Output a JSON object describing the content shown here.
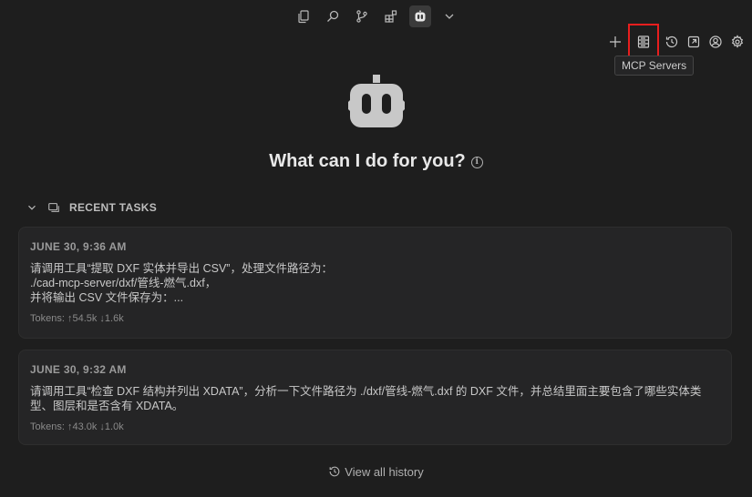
{
  "activity_bar": {
    "icons": [
      "copy-icon",
      "search-icon",
      "source-control-icon",
      "extensions-icon",
      "robot-icon",
      "chevron-down-icon"
    ]
  },
  "toolbar": {
    "icons": [
      "plus-icon",
      "mcp-servers-icon",
      "history-icon",
      "popout-icon",
      "account-icon",
      "settings-icon"
    ],
    "tooltip": "MCP Servers",
    "highlight_color": "#e81e1e"
  },
  "hero": {
    "title": "What can I do for you?",
    "info_glyph": "i"
  },
  "recent": {
    "header": "RECENT TASKS",
    "tasks": [
      {
        "date": "JUNE 30, 9:36 AM",
        "text": "请调用工具“提取 DXF 实体并导出 CSV”，处理文件路径为：\n./cad-mcp-server/dxf/管线-燃气.dxf，\n并将输出 CSV 文件保存为：...",
        "tokens": "Tokens: ↑54.5k ↓1.6k"
      },
      {
        "date": "JUNE 30, 9:32 AM",
        "text": "请调用工具“检查 DXF 结构并列出 XDATA”，分析一下文件路径为 ./dxf/管线-燃气.dxf 的 DXF 文件，并总结里面主要包含了哪些实体类型、图层和是否含有 XDATA。",
        "tokens": "Tokens: ↑43.0k ↓1.0k"
      }
    ]
  },
  "footer": {
    "view_all": "View all history"
  }
}
